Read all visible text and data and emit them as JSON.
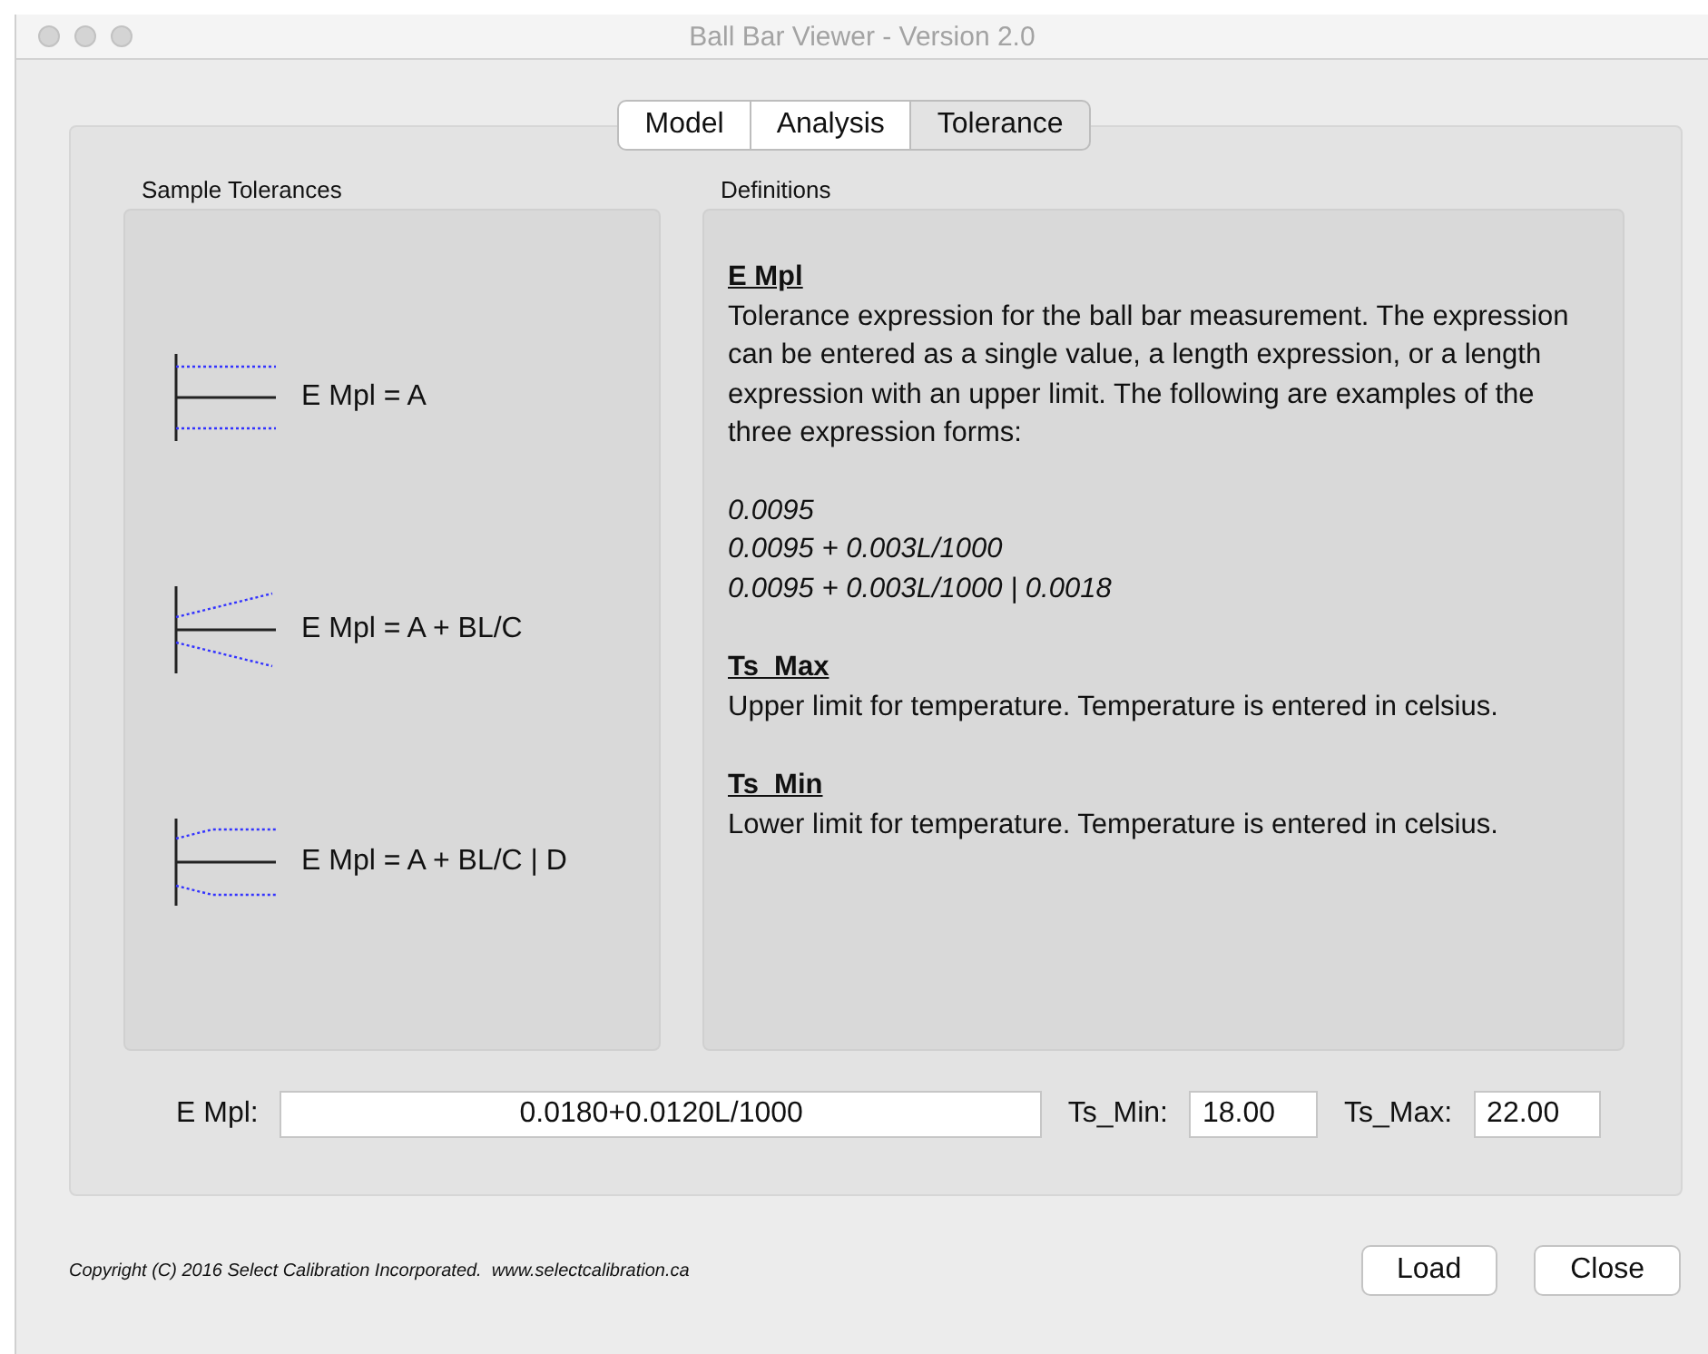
{
  "window": {
    "title": "Ball Bar Viewer - Version 2.0"
  },
  "tabs": [
    {
      "label": "Model",
      "selected": false
    },
    {
      "label": "Analysis",
      "selected": false
    },
    {
      "label": "Tolerance",
      "selected": true
    }
  ],
  "samples": {
    "label": "Sample Tolerances",
    "items": [
      {
        "kind": "constant",
        "formula": "E Mpl = A"
      },
      {
        "kind": "linear",
        "formula": "E Mpl = A + BL/C"
      },
      {
        "kind": "capped",
        "formula": "E Mpl = A + BL/C | D"
      }
    ]
  },
  "definitions": {
    "label": "Definitions",
    "items": [
      {
        "term": "E Mpl",
        "text": "Tolerance expression for the ball bar measurement. The expression can be entered as a single value, a length expression, or a length expression with an upper limit. The following are examples of the three expression forms:",
        "examples": [
          "0.0095",
          "0.0095 + 0.003L/1000",
          "0.0095 + 0.003L/1000 | 0.0018"
        ]
      },
      {
        "term": "Ts_Max",
        "text": "Upper limit for temperature. Temperature is entered in celsius."
      },
      {
        "term": "Ts_Min",
        "text": "Lower limit for temperature. Temperature is entered in celsius."
      }
    ]
  },
  "fields": [
    {
      "kind": "wide",
      "label": "E Mpl:",
      "value": "0.0180+0.0120L/1000"
    },
    {
      "kind": "narrow",
      "label": "Ts_Min:",
      "value": "18.00"
    },
    {
      "kind": "narrow",
      "label": "Ts_Max:",
      "value": "22.00"
    }
  ],
  "copyright": "Copyright (C) 2016 Select Calibration Incorporated.  www.selectcalibration.ca",
  "buttons": [
    "Load",
    "Close"
  ]
}
